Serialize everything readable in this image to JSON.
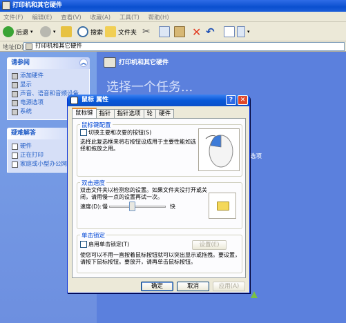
{
  "window": {
    "title": "打印机和其它硬件",
    "menu": [
      "文件(F)",
      "编辑(E)",
      "查看(V)",
      "收藏(A)",
      "工具(T)",
      "帮助(H)"
    ],
    "toolbar": {
      "back": "后退",
      "search": "搜索",
      "folders": "文件夹"
    },
    "address": {
      "label": "地址(D)",
      "value": "打印机和其它硬件"
    }
  },
  "sidebar": {
    "see_also": {
      "title": "请参阅",
      "items": [
        "添加硬件",
        "显示",
        "声音、语音和音频设备",
        "电源选项",
        "系统"
      ]
    },
    "troubleshoot": {
      "title": "疑难解答",
      "items": [
        "硬件",
        "正在打印",
        "家庭或小型办公网络"
      ]
    }
  },
  "content": {
    "header": "打印机和其它硬件",
    "task": "选择一个任务...",
    "side_text": "选项"
  },
  "dialog": {
    "title": "鼠标 属性",
    "help_glyph": "?",
    "close_glyph": "✕",
    "tabs": [
      "鼠标键",
      "指针",
      "指针选项",
      "轮",
      "硬件"
    ],
    "active_tab": 0,
    "buttons_config": {
      "title": "鼠标键配置",
      "checkbox_label": "切换主要和次要的按钮(S)",
      "desc": "选择此复选框来将右按钮设成用于主要性能如选择和拖放之用。"
    },
    "double_click": {
      "title": "双击速度",
      "desc": "双击文件夹以检测您的设置。如果文件夹没打开或关闭，请用慢一点的设置再试一次。",
      "speed_label": "速度(D):",
      "slow": "慢",
      "fast": "快",
      "speed_level": 0.4
    },
    "click_lock": {
      "title": "单击锁定",
      "checkbox_label": "启用单击锁定(T)",
      "settings_button": "设置(E)",
      "desc": "使您可以不用一直按着鼠标按钮就可以突出显示或拖拽。要设置，请按下鼠标按钮。要放开，请再单击鼠标按钮。"
    },
    "ok": "确定",
    "cancel": "取消",
    "apply": "应用(A)"
  }
}
